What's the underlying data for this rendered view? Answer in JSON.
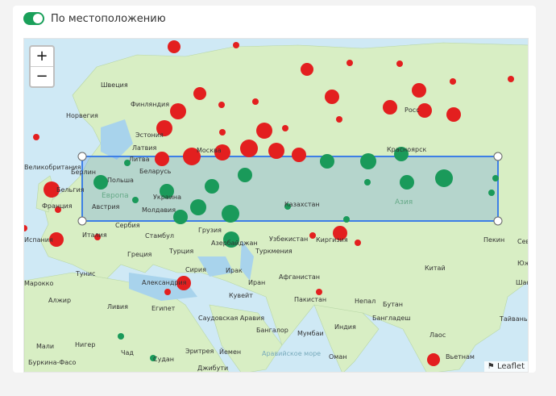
{
  "toggle": {
    "label": "По местоположению",
    "enabled": true,
    "accent_color": "#1aa05a"
  },
  "map": {
    "zoom_in_label": "+",
    "zoom_out_label": "−",
    "attribution": "Leaflet",
    "colors": {
      "red": "#e31f1f",
      "green": "#1a9a5a",
      "selection": "#3d7fe6"
    },
    "labels": [
      "Швеция",
      "Финляндия",
      "Норвегия",
      "Эстония",
      "Латвия",
      "Литва",
      "Москва",
      "Беларусь",
      "Польша",
      "Берлин",
      "Великобритания",
      "Бельгия",
      "Франция",
      "Украина",
      "Австрия",
      "Молдавия",
      "Европа",
      "Сербия",
      "Италия",
      "Испания",
      "Стамбул",
      "Греция",
      "Турция",
      "Алжир",
      "Тунис",
      "Сирия",
      "Александрия",
      "Ливия",
      "Египет",
      "Судан",
      "Эритрея",
      "Йемен",
      "Саудовская Аравия",
      "Кувейт",
      "Иран",
      "Ирак",
      "Азербайджан",
      "Грузия",
      "Туркмения",
      "Узбекистан",
      "Казахстан",
      "Киргизия",
      "Афганистан",
      "Пакистан",
      "Индия",
      "Непал",
      "Бутан",
      "Бангладеш",
      "Мумбаи",
      "Бангалор",
      "Оман",
      "Аравийское море",
      "Китай",
      "Пекин",
      "Лаос",
      "Вьетнам",
      "Тайвань",
      "Азия",
      "Росс",
      "Красноярск",
      "Нигер",
      "Мали",
      "Буркина-Фасо",
      "Чад",
      "Джибути",
      "Марокко",
      "Сев",
      "Юж",
      "Шанх"
    ],
    "selection": {
      "label": "selection rectangle"
    }
  }
}
